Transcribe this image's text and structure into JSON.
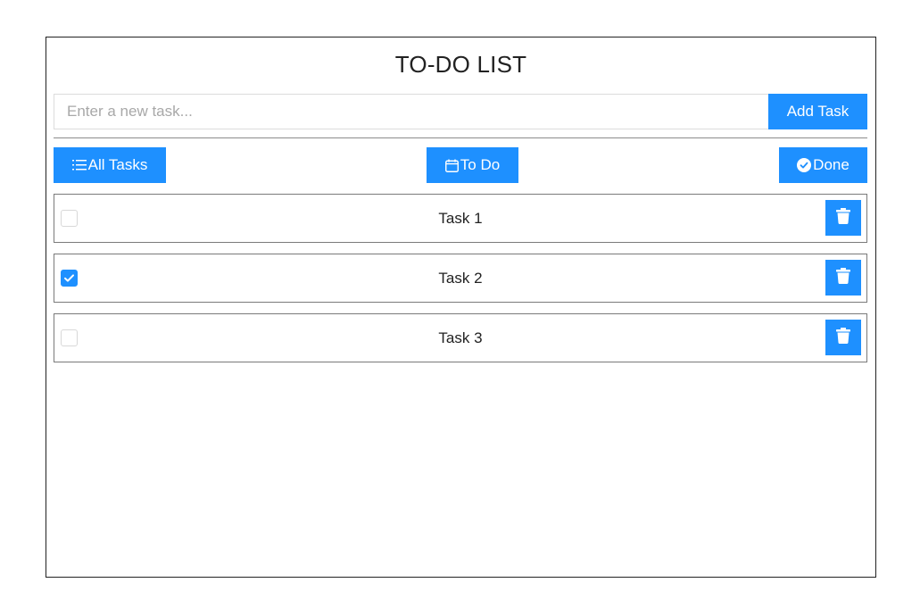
{
  "app": {
    "title": "TO-DO LIST"
  },
  "new_task": {
    "placeholder": "Enter a new task...",
    "value": "",
    "add_label": "Add Task"
  },
  "filters": {
    "all_label": "All Tasks",
    "todo_label": "To Do",
    "done_label": "Done",
    "all_icon": "list-icon",
    "todo_icon": "calendar-icon",
    "done_icon": "check-circle-icon"
  },
  "tasks": [
    {
      "label": "Task 1",
      "done": false
    },
    {
      "label": "Task 2",
      "done": true
    },
    {
      "label": "Task 3",
      "done": false
    }
  ],
  "task_actions": {
    "delete_icon": "trash-icon"
  },
  "colors": {
    "accent": "#1e90ff",
    "border": "#7a7a7a",
    "text": "#222222"
  }
}
